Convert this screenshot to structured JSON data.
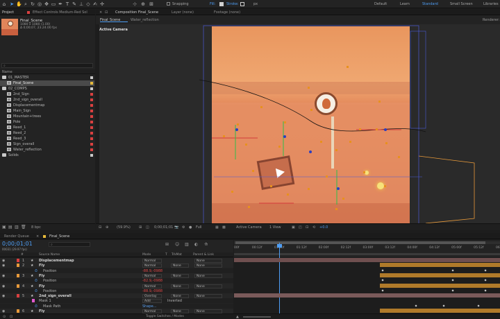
{
  "toolbar": {
    "snapping": "Snapping",
    "fill_label": "Fill:",
    "stroke_label": "Stroke:",
    "stroke_value": "px",
    "workspaces": [
      "Default",
      "Learn",
      "Standard",
      "Small Screen",
      "Libraries"
    ],
    "active_workspace": "Standard"
  },
  "project_panel": {
    "tab": "Project",
    "effect_tab": "Effect Controls Medium-Red Sol",
    "comp_name": "Final_Scene",
    "comp_info_1": "1080 x 1080 (1.00)",
    "comp_info_2": "Δ 0;00;07, 23.24.00 fps",
    "search_placeholder": "",
    "column_name": "Name",
    "items": [
      {
        "name": "01_MASTER",
        "type": "folder",
        "label": "#c9c9c9",
        "indent": 0
      },
      {
        "name": "Final_Scene",
        "type": "comp",
        "label": "#e6b93a",
        "indent": 1,
        "selected": true
      },
      {
        "name": "02_COMPS",
        "type": "folder",
        "label": "#c9c9c9",
        "indent": 0
      },
      {
        "name": "2nd_Sign",
        "type": "comp",
        "label": "#d94040",
        "indent": 1
      },
      {
        "name": "2nd_sign_overall",
        "type": "comp",
        "label": "#d94040",
        "indent": 1
      },
      {
        "name": "Displacementmap",
        "type": "comp",
        "label": "#d94040",
        "indent": 1
      },
      {
        "name": "Main_Sign",
        "type": "comp",
        "label": "#d94040",
        "indent": 1
      },
      {
        "name": "Mountain+trees",
        "type": "comp",
        "label": "#d94040",
        "indent": 1
      },
      {
        "name": "Pole",
        "type": "comp",
        "label": "#d94040",
        "indent": 1
      },
      {
        "name": "Reed_1",
        "type": "comp",
        "label": "#d94040",
        "indent": 1
      },
      {
        "name": "Reed_2",
        "type": "comp",
        "label": "#d94040",
        "indent": 1
      },
      {
        "name": "Reed_3",
        "type": "comp",
        "label": "#d94040",
        "indent": 1
      },
      {
        "name": "Sign_overall",
        "type": "comp",
        "label": "#d94040",
        "indent": 1
      },
      {
        "name": "Water_reflection",
        "type": "comp",
        "label": "#d94040",
        "indent": 1
      },
      {
        "name": "Solids",
        "type": "folder",
        "label": "#c9c9c9",
        "indent": 0
      }
    ],
    "bpc": "8 bpc"
  },
  "composition_panel": {
    "tab_label": "Composition Final_Scene",
    "layer_tab": "Layer (none)",
    "footage_tab": "Footage (none)",
    "renderer": "Renderer:",
    "subtabs": [
      "Final_Scene",
      "Water_reflection"
    ],
    "active_camera": "Active Camera",
    "zoom": "(59.9%)",
    "timecode": "0;00;01;01",
    "resolution": "Full",
    "camera": "Active Camera",
    "views": "1 View",
    "exposure": "+0.0"
  },
  "timeline": {
    "render_queue_tab": "Render Queue",
    "comp_tab": "Final_Scene",
    "current_time": "0;00;01;01",
    "frame_info": "00031 (29.97 fps)",
    "col_source": "Source Name",
    "col_mode": "Mode",
    "col_t": "T",
    "col_trkmat": "TrkMat",
    "col_parent": "Parent & Link",
    "ruler": [
      "00f",
      "00:12f",
      "01:00f",
      "01:12f",
      "02:00f",
      "02:12f",
      "03:00f",
      "03:12f",
      "04:00f",
      "04:12f",
      "05:00f",
      "05:12f",
      "06:00f"
    ],
    "rows": [
      {
        "num": "1",
        "name": "Displacementmap",
        "mode": "Normal",
        "trkmat": "",
        "parent": "None",
        "kind": "layer",
        "label": "#d94040"
      },
      {
        "num": "2",
        "name": "Fly",
        "mode": "Normal",
        "trkmat": "None",
        "parent": "None",
        "kind": "layer",
        "label": "#e89a3a"
      },
      {
        "num": "",
        "name": "Position",
        "value": "-88.9,-0988",
        "kind": "prop"
      },
      {
        "num": "3",
        "name": "Fly",
        "mode": "Normal",
        "trkmat": "None",
        "parent": "None",
        "kind": "layer",
        "label": "#e89a3a"
      },
      {
        "num": "",
        "name": "Position",
        "value": "-82.9,-0988",
        "kind": "prop"
      },
      {
        "num": "4",
        "name": "Fly",
        "mode": "Normal",
        "trkmat": "None",
        "parent": "None",
        "kind": "layer",
        "label": "#e89a3a"
      },
      {
        "num": "",
        "name": "Position",
        "value": "-88.9,-0988",
        "kind": "prop"
      },
      {
        "num": "5",
        "name": "2nd_sign_overall",
        "mode": "Overlay",
        "trkmat": "None",
        "parent": "None",
        "kind": "layer",
        "label": "#d94040"
      },
      {
        "num": "",
        "name": "Mask 1",
        "mode": "Add",
        "trkmat": "Inverted",
        "kind": "mask"
      },
      {
        "num": "",
        "name": "Mask Path",
        "value": "Shape...",
        "kind": "prop"
      },
      {
        "num": "6",
        "name": "Fly",
        "mode": "Normal",
        "trkmat": "None",
        "parent": "None",
        "kind": "layer",
        "label": "#e89a3a"
      }
    ],
    "toggle_label": "Toggle Switches / Modes"
  },
  "colors": {
    "accent": "#4e9ef5",
    "selected_label": "#e6b93a",
    "layer_bar": "#b07a2a",
    "scene": "#e08a5a"
  }
}
